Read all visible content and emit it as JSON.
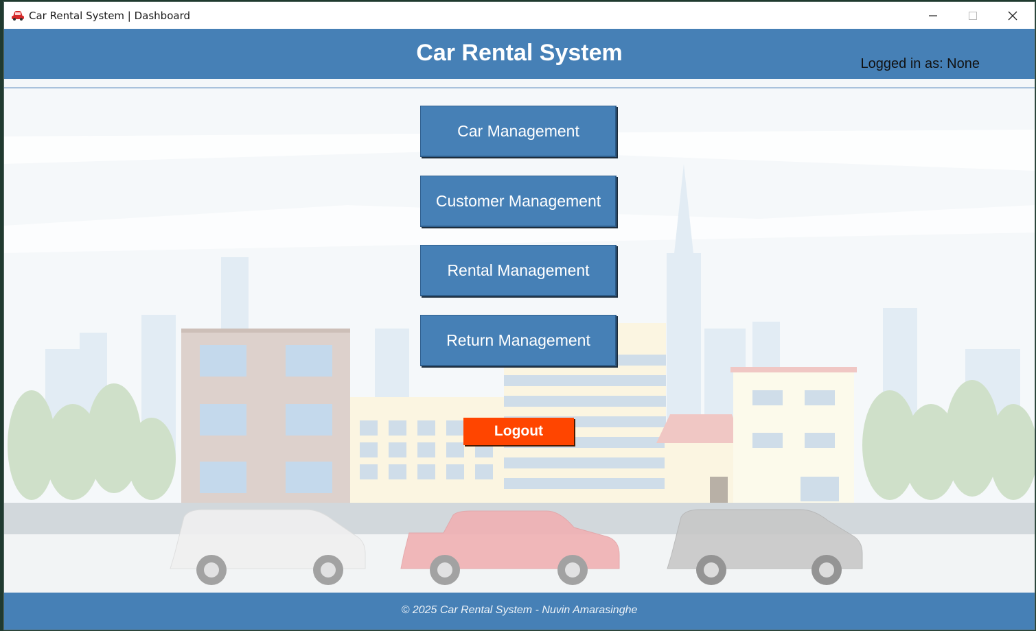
{
  "window": {
    "title": "Car Rental System | Dashboard",
    "icon": "red-car-icon",
    "controls": [
      "minimize",
      "maximize",
      "close"
    ]
  },
  "header": {
    "title": "Car Rental System",
    "login_status": "Logged in as: None"
  },
  "menu": {
    "items": [
      {
        "label": "Car Management"
      },
      {
        "label": "Customer Management"
      },
      {
        "label": "Rental Management"
      },
      {
        "label": "Return Management"
      }
    ],
    "logout_label": "Logout"
  },
  "footer": {
    "text": "© 2025 Car Rental System - Nuvin Amarasinghe"
  },
  "colors": {
    "primary": "#4680b6",
    "logout": "#ff4500",
    "header_text": "#ffffff"
  }
}
